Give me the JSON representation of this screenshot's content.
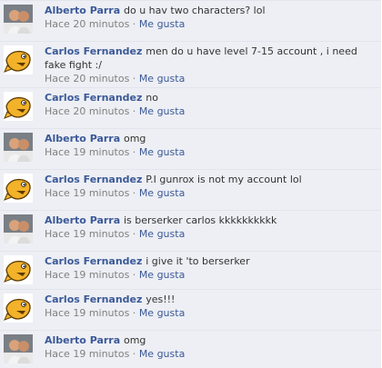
{
  "comments": [
    {
      "author": "Alberto Parra",
      "avatar": "person-photo",
      "text": "do u hav two characters? lol",
      "time": "Hace 20 minutos",
      "like": "Me gusta"
    },
    {
      "author": "Carlos Fernandez",
      "avatar": "cartoon-fish",
      "text": "men do u have level 7-15 account , i need fake fight :/",
      "time": "Hace 20 minutos",
      "like": "Me gusta"
    },
    {
      "author": "Carlos Fernandez",
      "avatar": "cartoon-fish",
      "text": "no",
      "time": "Hace 20 minutos",
      "like": "Me gusta"
    },
    {
      "author": "Alberto Parra",
      "avatar": "person-photo",
      "text": "omg",
      "time": "Hace 19 minutos",
      "like": "Me gusta"
    },
    {
      "author": "Carlos Fernandez",
      "avatar": "cartoon-fish",
      "text": "P.I gunrox is not my account lol",
      "time": "Hace 19 minutos",
      "like": "Me gusta"
    },
    {
      "author": "Alberto Parra",
      "avatar": "person-photo",
      "text": "is berserker carlos kkkkkkkkkk",
      "time": "Hace 19 minutos",
      "like": "Me gusta"
    },
    {
      "author": "Carlos Fernandez",
      "avatar": "cartoon-fish",
      "text": "i give it 'to berserker",
      "time": "Hace 19 minutos",
      "like": "Me gusta"
    },
    {
      "author": "Carlos Fernandez",
      "avatar": "cartoon-fish",
      "text": "yes!!!",
      "time": "Hace 19 minutos",
      "like": "Me gusta"
    },
    {
      "author": "Alberto Parra",
      "avatar": "person-photo",
      "text": "omg",
      "time": "Hace 19 minutos",
      "like": "Me gusta"
    }
  ],
  "separator": " · ",
  "colors": {
    "link": "#3b5998",
    "meta": "#808080",
    "background": "#edeff4"
  }
}
